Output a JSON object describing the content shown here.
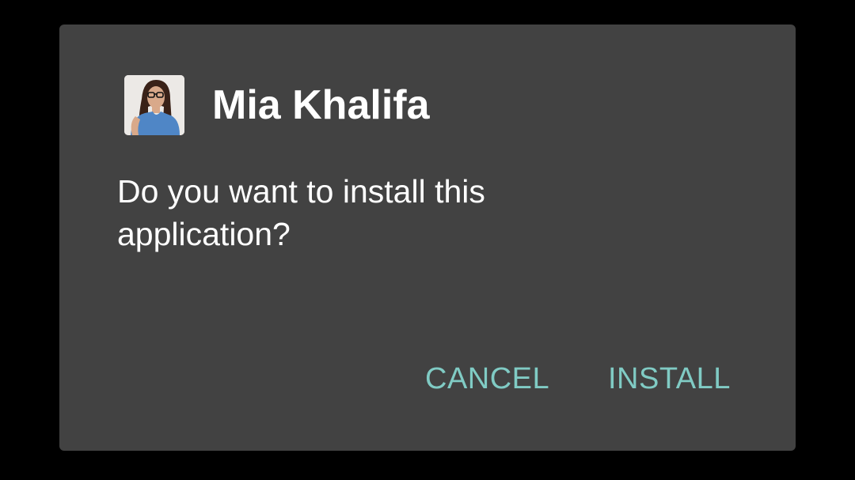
{
  "dialog": {
    "app_name": "Mia Khalifa",
    "message": "Do you want to install this application?",
    "cancel_label": "CANCEL",
    "install_label": "INSTALL",
    "app_icon": "app-avatar-icon"
  },
  "colors": {
    "background": "#000000",
    "dialog_background": "#424242",
    "text": "#ffffff",
    "accent": "#80cbc4"
  }
}
